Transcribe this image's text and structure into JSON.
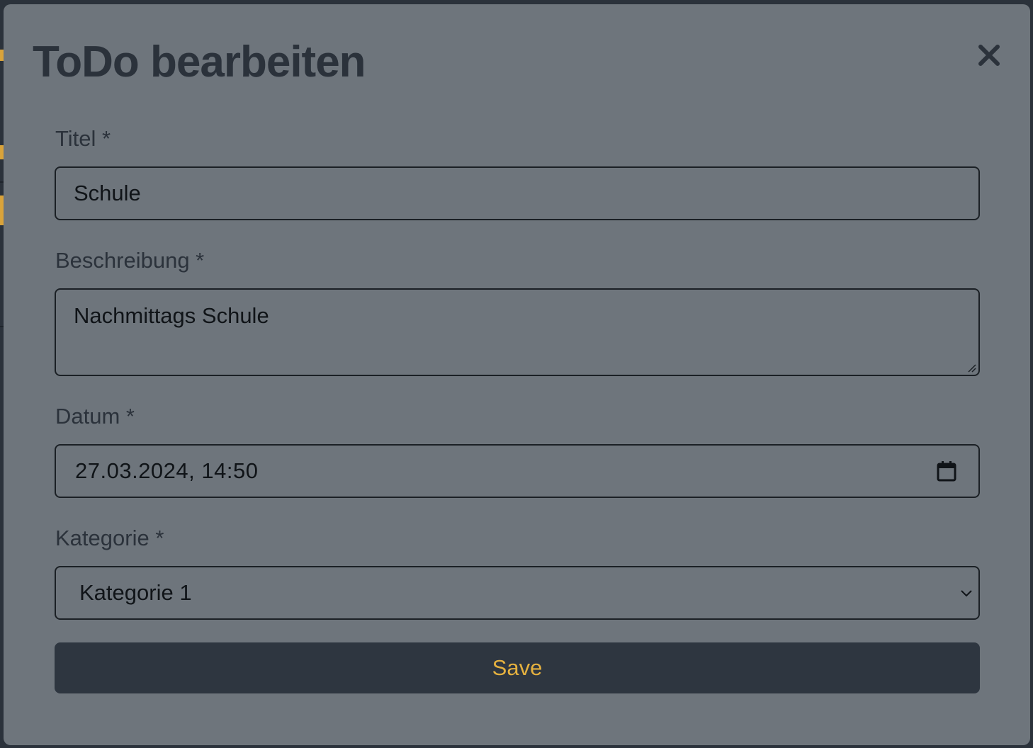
{
  "modal": {
    "title": "ToDo bearbeiten",
    "close_icon": "close-icon"
  },
  "form": {
    "title_label": "Titel *",
    "title_value": "Schule",
    "description_label": "Beschreibung *",
    "description_value": "Nachmittags Schule",
    "date_label": "Datum *",
    "date_value": "27.03.2024, 14:50",
    "category_label": "Kategorie *",
    "category_value": "Kategorie 1",
    "save_label": "Save"
  },
  "colors": {
    "modal_background": "#6e757c",
    "text_dark": "#2b323b",
    "button_background": "#2e3640",
    "button_text": "#e5b13f",
    "page_background": "#2b323b"
  }
}
